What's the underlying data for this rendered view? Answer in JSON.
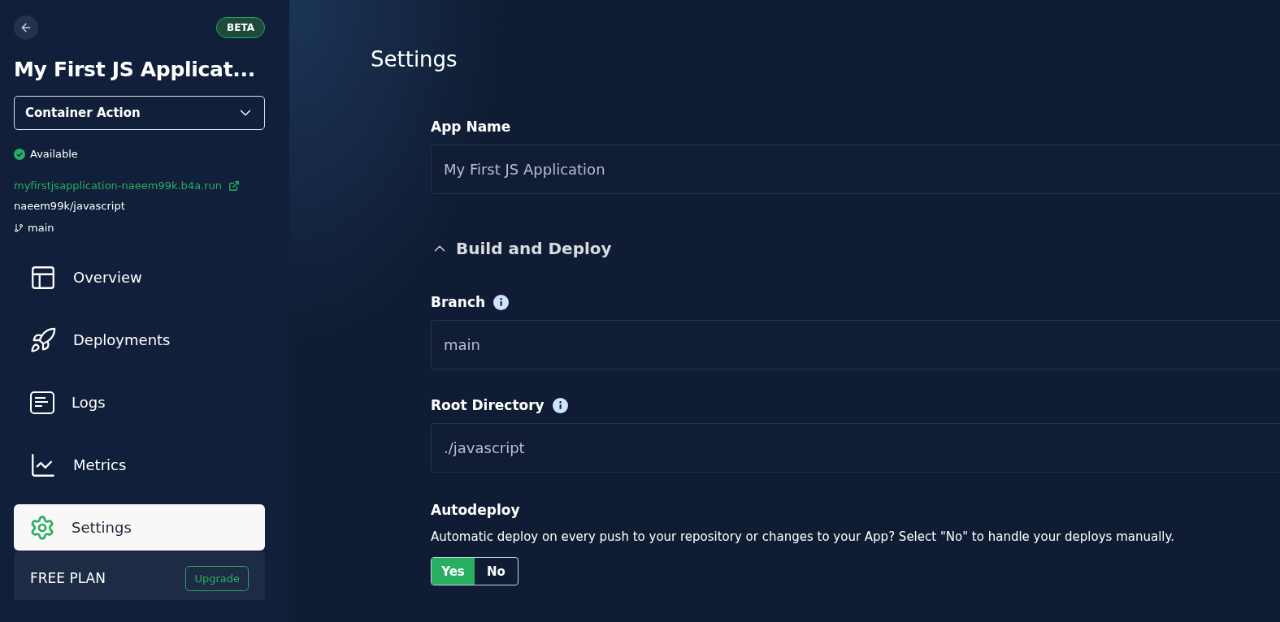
{
  "sidebar": {
    "badge": "BETA",
    "app_title": "My First JS Applicat...",
    "action_select": {
      "value": "Container Action"
    },
    "status": {
      "label": "Available"
    },
    "url": "myfirstjsapplication-naeem99k.b4a.run",
    "repo": "naeem99k/javascript",
    "branch": "main",
    "nav": [
      {
        "kind": "overview",
        "label": "Overview",
        "selected": false
      },
      {
        "kind": "deployments",
        "label": "Deployments",
        "selected": false
      },
      {
        "kind": "logs",
        "label": "Logs",
        "selected": false
      },
      {
        "kind": "metrics",
        "label": "Metrics",
        "selected": false
      },
      {
        "kind": "settings",
        "label": "Settings",
        "selected": true
      }
    ],
    "plan": {
      "label": "FREE PLAN",
      "button": "Upgrade"
    }
  },
  "main": {
    "title": "Settings",
    "app_name": {
      "label": "App Name",
      "value": "My First JS Application"
    },
    "section": {
      "title": "Build and Deploy",
      "expanded": true
    },
    "branch": {
      "label": "Branch",
      "value": "main"
    },
    "root_directory": {
      "label": "Root Directory",
      "value": "./javascript"
    },
    "autodeploy": {
      "label": "Autodeploy",
      "description": "Automatic deploy on every push to your repository or changes to your App? Select \"No\" to handle your deploys manually.",
      "options": [
        {
          "label": "Yes",
          "selected": true
        },
        {
          "label": "No",
          "selected": false
        }
      ]
    }
  }
}
